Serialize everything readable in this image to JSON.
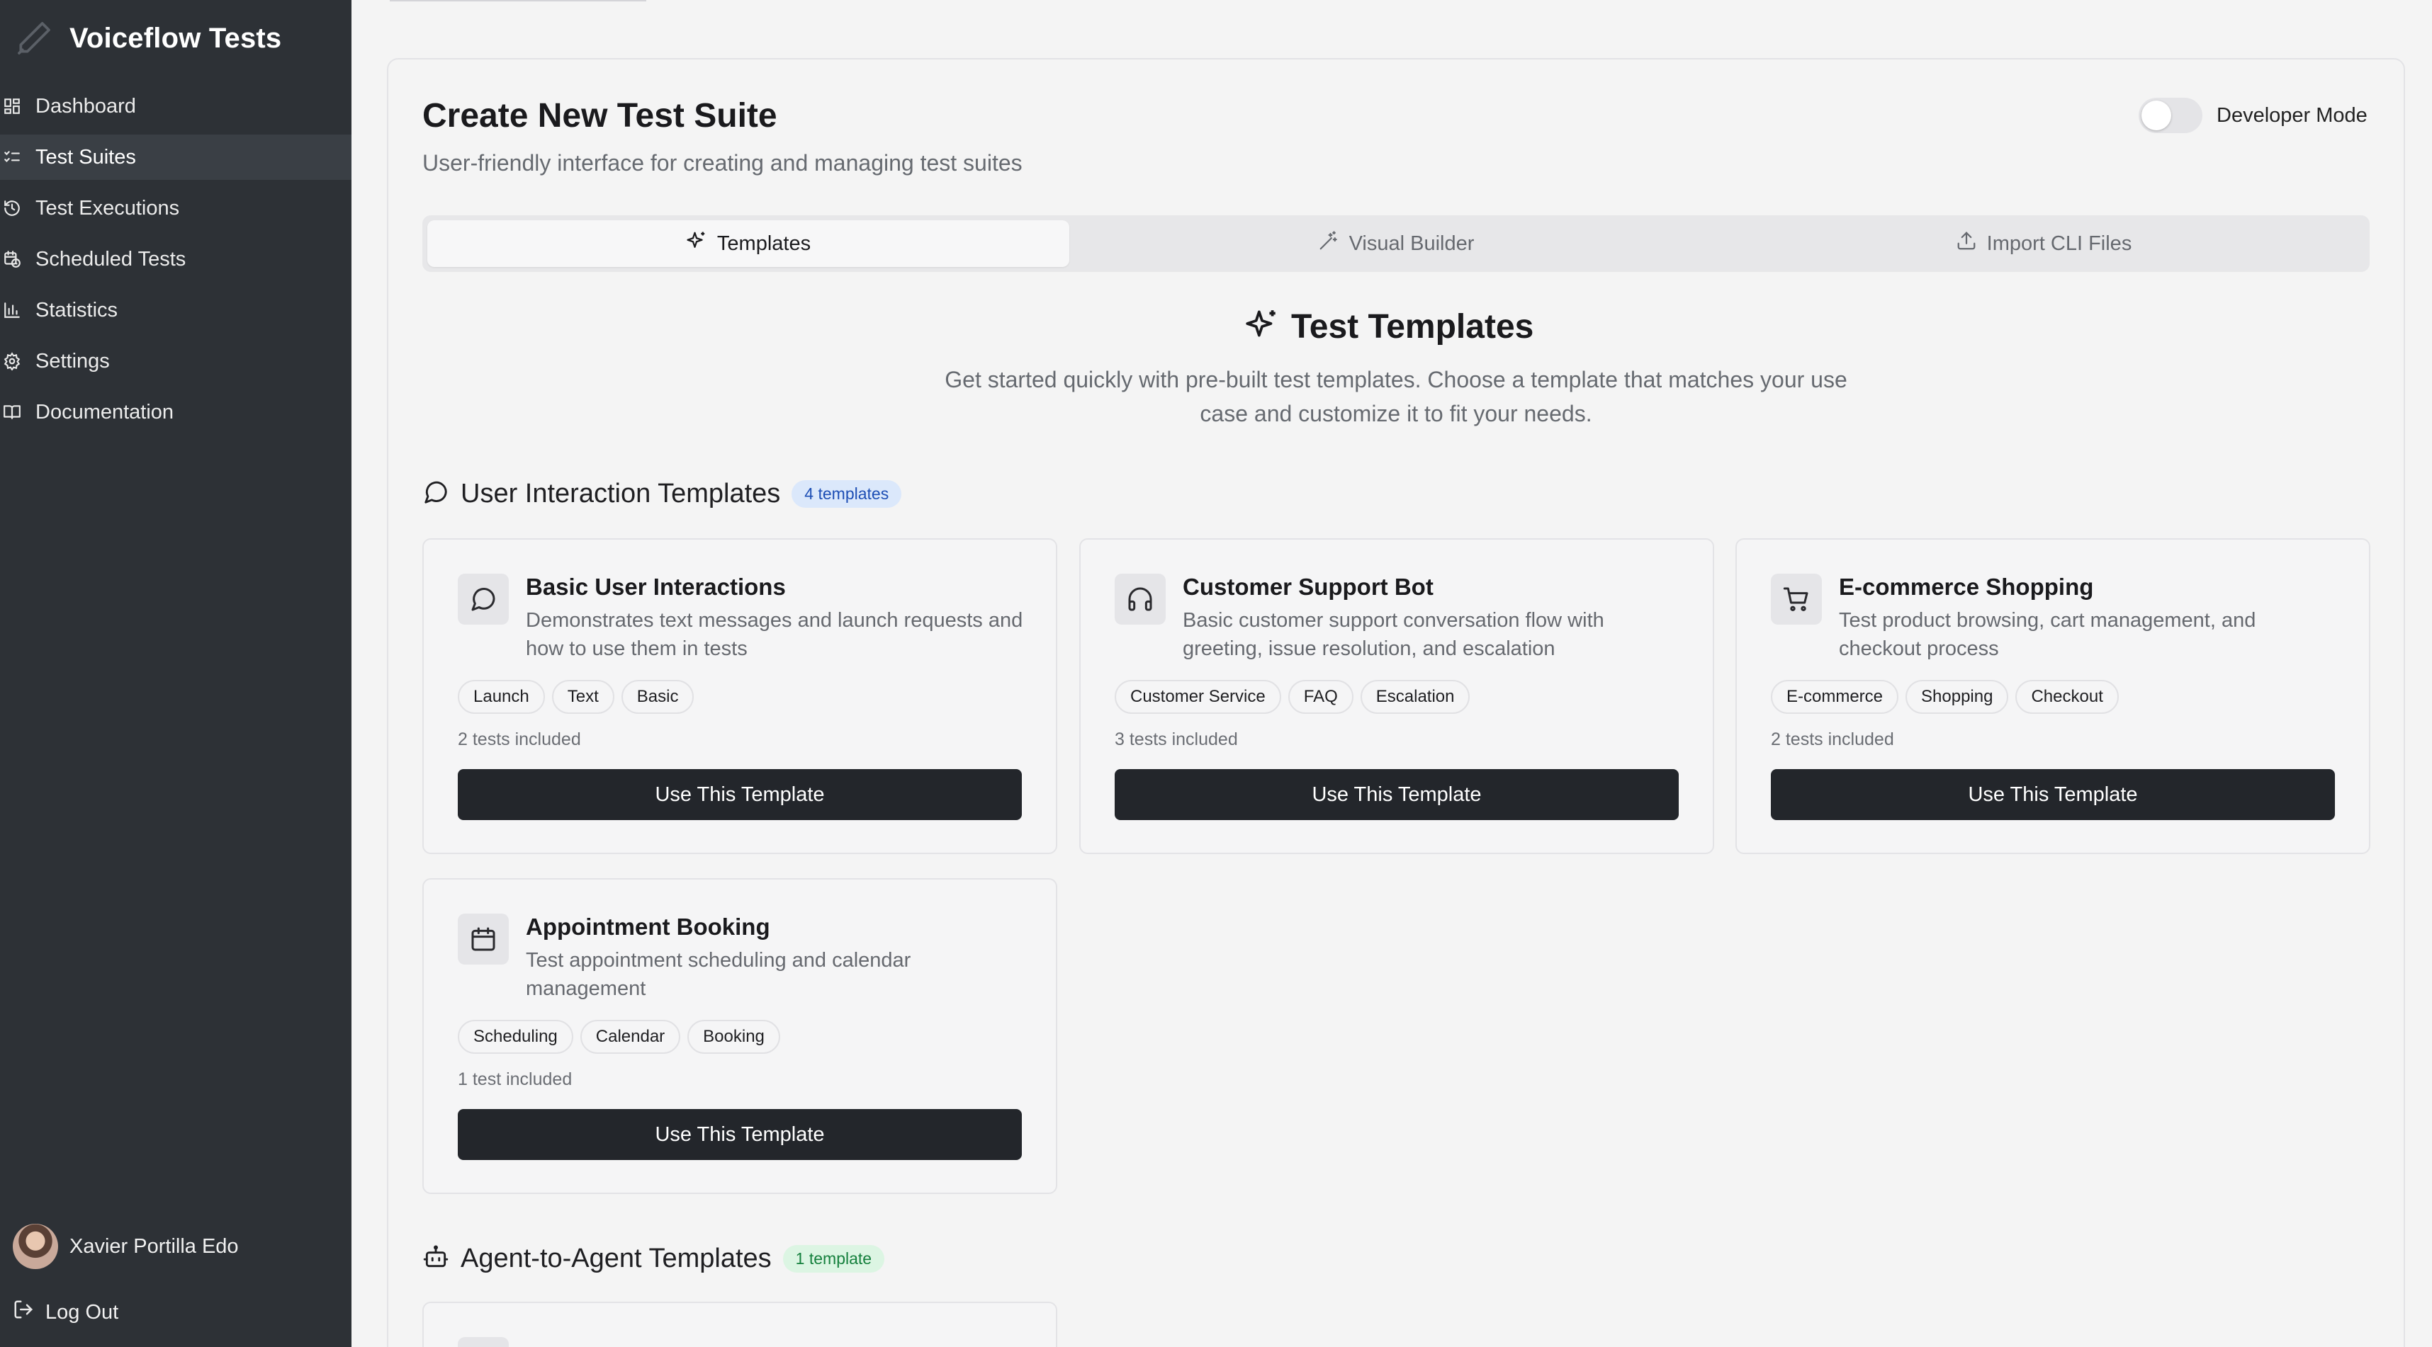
{
  "app": {
    "title": "Voiceflow Tests",
    "logo_icon": "pencil-icon"
  },
  "sidebar": {
    "items": [
      {
        "label": "Dashboard",
        "icon": "dashboard-icon",
        "active": false
      },
      {
        "label": "Test Suites",
        "icon": "list-checks-icon",
        "active": true
      },
      {
        "label": "Test Executions",
        "icon": "history-icon",
        "active": false
      },
      {
        "label": "Scheduled Tests",
        "icon": "calendar-clock-icon",
        "active": false
      },
      {
        "label": "Statistics",
        "icon": "bar-chart-icon",
        "active": false
      },
      {
        "label": "Settings",
        "icon": "gear-icon",
        "active": false
      },
      {
        "label": "Documentation",
        "icon": "book-icon",
        "active": false
      }
    ],
    "user": {
      "name": "Xavier Portilla Edo"
    },
    "logout_label": "Log Out"
  },
  "page": {
    "title": "Create New Test Suite",
    "subtitle": "User-friendly interface for creating and managing test suites",
    "developer_mode": {
      "label": "Developer Mode",
      "enabled": false
    }
  },
  "tabs": [
    {
      "label": "Templates",
      "icon": "sparkles-icon",
      "active": true
    },
    {
      "label": "Visual Builder",
      "icon": "magic-wand-icon",
      "active": false
    },
    {
      "label": "Import CLI Files",
      "icon": "upload-icon",
      "active": false
    }
  ],
  "templates_section": {
    "title": "Test Templates",
    "description": "Get started quickly with pre-built test templates. Choose a template that matches your use case and customize it to fit your needs."
  },
  "user_interaction": {
    "title": "User Interaction Templates",
    "badge": "4 templates",
    "cards": [
      {
        "name": "Basic User Interactions",
        "description": "Demonstrates text messages and launch requests and how to use them in tests",
        "tags": [
          "Launch",
          "Text",
          "Basic"
        ],
        "count": "2 tests included",
        "button": "Use This Template",
        "icon": "message-circle-icon"
      },
      {
        "name": "Customer Support Bot",
        "description": "Basic customer support conversation flow with greeting, issue resolution, and escalation",
        "tags": [
          "Customer Service",
          "FAQ",
          "Escalation"
        ],
        "count": "3 tests included",
        "button": "Use This Template",
        "icon": "headphones-icon"
      },
      {
        "name": "E-commerce Shopping",
        "description": "Test product browsing, cart management, and checkout process",
        "tags": [
          "E-commerce",
          "Shopping",
          "Checkout"
        ],
        "count": "2 tests included",
        "button": "Use This Template",
        "icon": "shopping-cart-icon"
      },
      {
        "name": "Appointment Booking",
        "description": "Test appointment scheduling and calendar management",
        "tags": [
          "Scheduling",
          "Calendar",
          "Booking"
        ],
        "count": "1 test included",
        "button": "Use This Template",
        "icon": "calendar-icon"
      }
    ]
  },
  "agent_to_agent": {
    "title": "Agent-to-Agent Templates",
    "badge": "1 template"
  }
}
